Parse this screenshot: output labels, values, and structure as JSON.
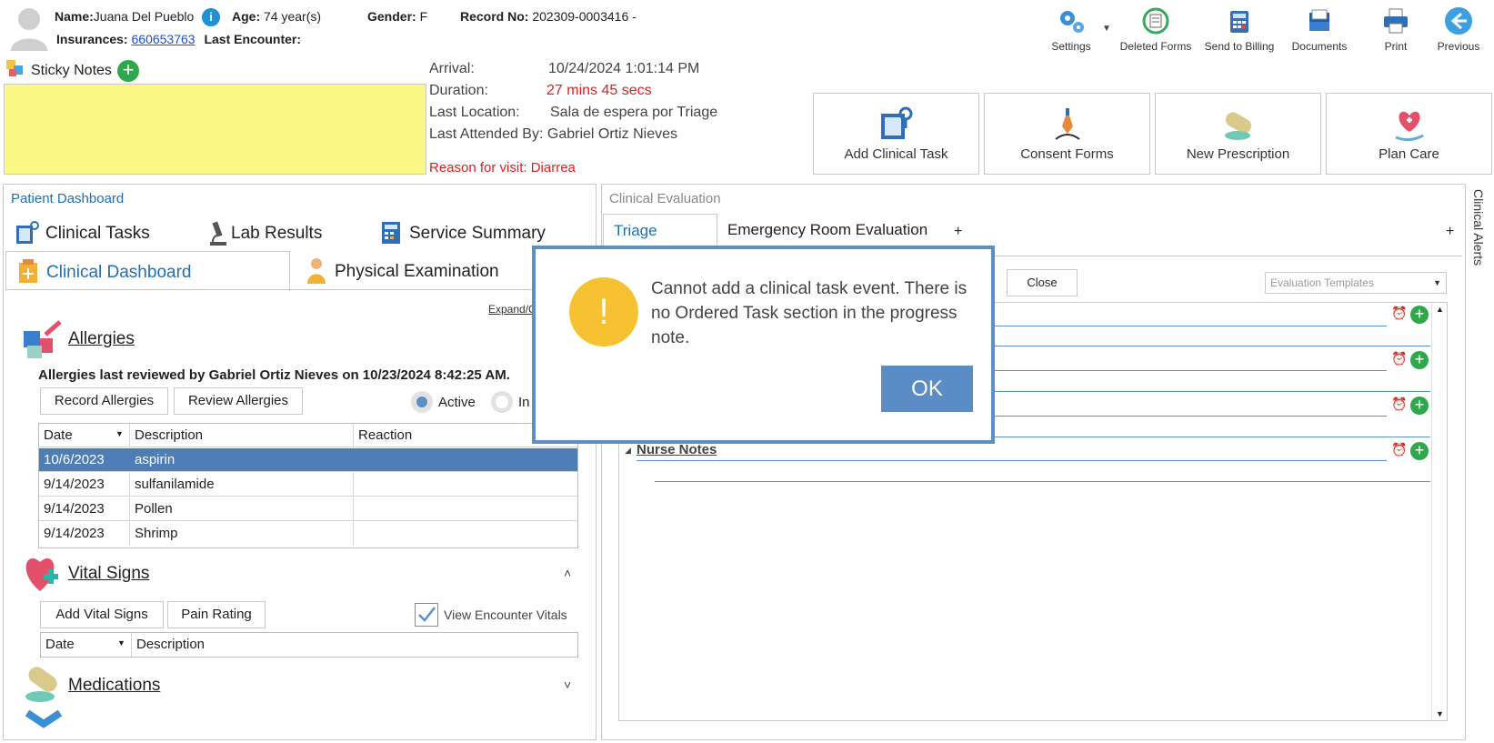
{
  "patient": {
    "name_label": "Name:",
    "name": "Juana Del Pueblo",
    "age_label": "Age:",
    "age": "74 year(s)",
    "gender_label": "Gender:",
    "gender": "F",
    "record_label": "Record No:",
    "record": "202309-0003416 -",
    "insurances_label": "Insurances:",
    "insurance": "660653763",
    "last_encounter_label": "Last Encounter:"
  },
  "toolbar": {
    "settings": "Settings",
    "deleted_forms": "Deleted Forms",
    "send_to_billing": "Send to Billing",
    "documents": "Documents",
    "print": "Print",
    "previous": "Previous"
  },
  "sticky_notes": {
    "label": "Sticky Notes"
  },
  "visit": {
    "arrival_label": "Arrival:",
    "arrival": "10/24/2024 1:01:14 PM",
    "duration_label": "Duration:",
    "duration": "27 mins 45 secs",
    "location_label": "Last Location:",
    "location": "Sala de espera por Triage",
    "attended": "Last Attended By: Gabriel Ortiz Nieves",
    "reason": "Reason for visit: Diarrea"
  },
  "actions": {
    "add_clinical_task": "Add Clinical Task",
    "consent_forms": "Consent Forms",
    "new_prescription": "New Prescription",
    "plan_care": "Plan Care"
  },
  "dashboard": {
    "title": "Patient Dashboard",
    "tabs_top": [
      "Clinical Tasks",
      "Lab Results",
      "Service Summary"
    ],
    "tabs_bottom": [
      "Clinical Dashboard",
      "Physical Examination"
    ],
    "expand": "Expand/C"
  },
  "allergies": {
    "title": "Allergies",
    "reviewed": "Allergies last reviewed by Gabriel Ortiz Nieves on 10/23/2024 8:42:25 AM.",
    "record_btn": "Record Allergies",
    "review_btn": "Review Allergies",
    "active_label": "Active",
    "inactive_label": "In",
    "columns": [
      "Date",
      "Description",
      "Reaction"
    ],
    "rows": [
      {
        "date": "10/6/2023",
        "description": "aspirin",
        "reaction": ""
      },
      {
        "date": "9/14/2023",
        "description": "sulfanilamide",
        "reaction": ""
      },
      {
        "date": "9/14/2023",
        "description": "Pollen",
        "reaction": ""
      },
      {
        "date": "9/14/2023",
        "description": "Shrimp",
        "reaction": ""
      }
    ]
  },
  "vitals": {
    "title": "Vital Signs",
    "add_btn": "Add Vital Signs",
    "pain_btn": "Pain Rating",
    "view_encounter": "View Encounter Vitals",
    "columns": [
      "Date",
      "Description"
    ]
  },
  "medications": {
    "title": "Medications"
  },
  "evaluation": {
    "title": "Clinical Evaluation",
    "tabs": [
      "Triage",
      "Emergency Room Evaluation"
    ],
    "add_tab": "+",
    "close_btn": "Close",
    "templates_placeholder": "Evaluation Templates",
    "nurse_notes": "Nurse Notes"
  },
  "clinical_alerts": "Clinical Alerts",
  "dialog": {
    "message": "Cannot add a clinical task event. There is no Ordered Task section in the progress note.",
    "ok": "OK",
    "icon_glyph": "!"
  },
  "colors": {
    "accent": "#1f6fb5",
    "selected_row": "#4f7db8",
    "sticky": "#fbf886",
    "red": "#e02020",
    "ok_btn": "#5b8cc6",
    "warning": "#f6c232"
  }
}
